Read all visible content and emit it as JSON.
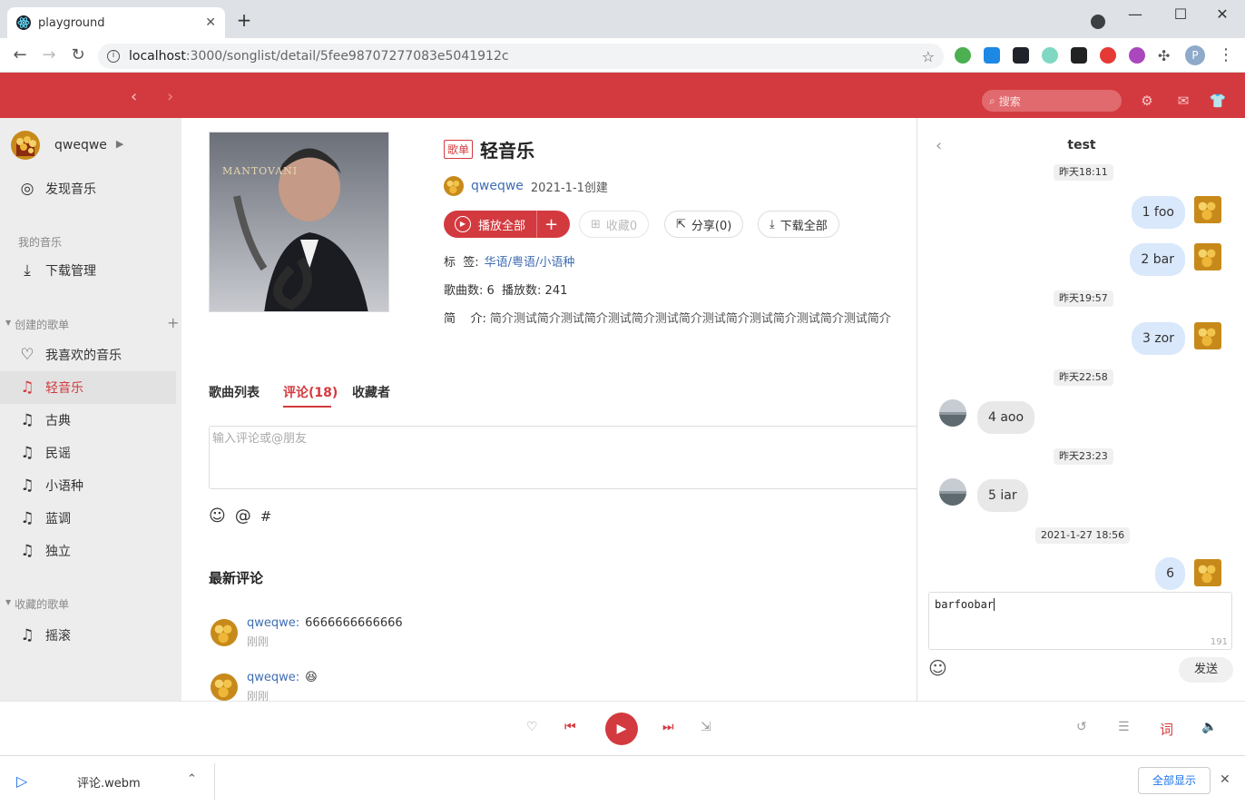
{
  "browser": {
    "tab_title": "playground",
    "url_host": "localhost",
    "url_rest": ":3000/songlist/detail/5fee98707277083e5041912c"
  },
  "header": {
    "search_placeholder": "搜索"
  },
  "sidebar": {
    "username": "qweqwe",
    "discover": "发现音乐",
    "my_music_head": "我的音乐",
    "download": "下载管理",
    "created_head": "创建的歌单",
    "created": [
      "我喜欢的音乐",
      "轻音乐",
      "古典",
      "民谣",
      "小语种",
      "蓝调",
      "独立"
    ],
    "collected_head": "收藏的歌单",
    "collected": [
      "摇滚"
    ]
  },
  "playlist": {
    "badge": "歌单",
    "title": "轻音乐",
    "creator": "qweqwe",
    "created_date": "2021-1-1创建",
    "play_all": "播放全部",
    "collect": "收藏0",
    "share": "分享(0)",
    "download_all": "下载全部",
    "tags_label": "标  签:",
    "tags": "华语/粤语/小语种",
    "stats": "歌曲数: 6  播放数: 241",
    "intro_label": "简    介:",
    "intro": "简介测试简介测试简介测试简介测试简介测试简介测试简介测试简介测试简介",
    "cover_text": "MANTOVANI"
  },
  "tabs": {
    "songs": "歌曲列表",
    "comments": "评论(18)",
    "collectors": "收藏者"
  },
  "comment_box": {
    "placeholder": "输入评论或@朋友",
    "at": "@",
    "hash": "#"
  },
  "latest_comments": {
    "title": "最新评论",
    "items": [
      {
        "user": "qweqwe:",
        "text": "6666666666666",
        "time": "刚刚"
      },
      {
        "user": "qweqwe:",
        "text": "😆",
        "time": "刚刚"
      }
    ]
  },
  "chat": {
    "title": "test",
    "messages": [
      {
        "kind": "time",
        "text": "昨天18:11"
      },
      {
        "kind": "me",
        "text": "1 foo"
      },
      {
        "kind": "me",
        "text": "2 bar"
      },
      {
        "kind": "time",
        "text": "昨天19:57"
      },
      {
        "kind": "me",
        "text": "3 zor"
      },
      {
        "kind": "time",
        "text": "昨天22:58"
      },
      {
        "kind": "them",
        "text": "4 aoo"
      },
      {
        "kind": "time",
        "text": "昨天23:23"
      },
      {
        "kind": "them",
        "text": "5 iar"
      },
      {
        "kind": "time",
        "text": "2021-1-27 18:56"
      },
      {
        "kind": "me",
        "text": "6"
      }
    ],
    "input_value": "barfoobar",
    "remaining": "191",
    "send": "发送"
  },
  "player": {
    "lyrics": "词"
  },
  "download_bar": {
    "filename": "评论.webm",
    "show_all": "全部显示"
  },
  "colors": {
    "brand_red": "#d33a3f",
    "link_blue": "#3f6db3",
    "bubble_me": "#d9e8fb",
    "bubble_them": "#e8e8e8"
  }
}
